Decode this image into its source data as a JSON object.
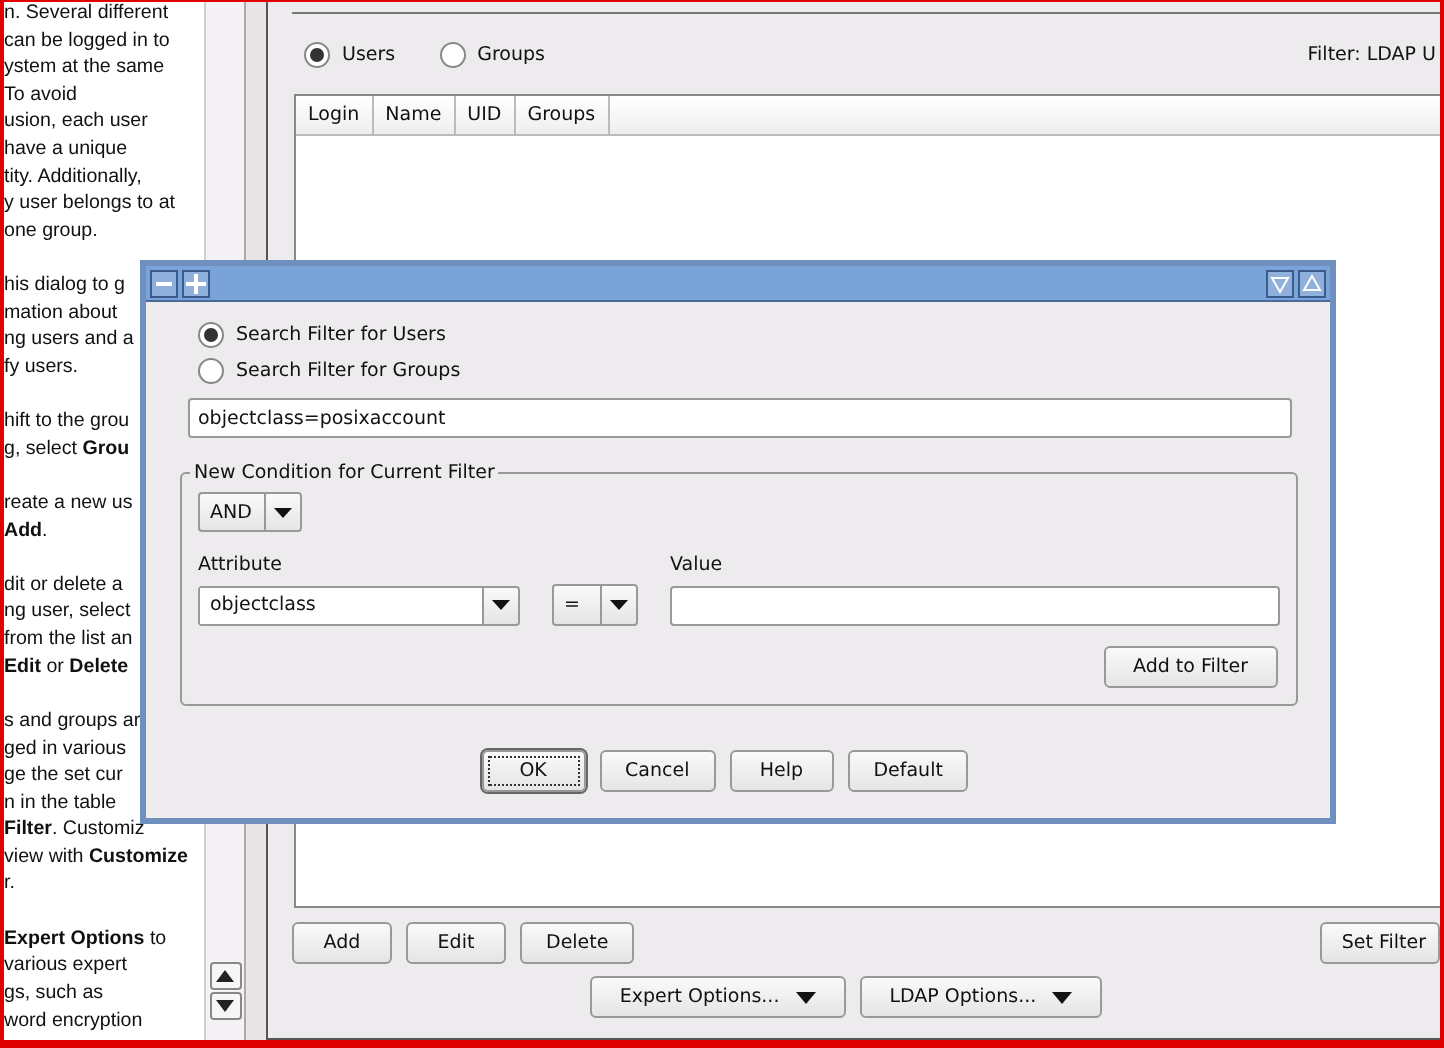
{
  "help_panel": {
    "paragraphs": [
      {
        "lines": [
          "n. Several different",
          "can be logged in to",
          "ystem at the same",
          "To avoid",
          "usion, each user",
          "have a unique",
          "tity. Additionally,",
          "y user belongs to at",
          "one group."
        ]
      },
      {
        "lines": [
          "his dialog to g",
          "mation about",
          "ng users and a",
          "fy users."
        ]
      },
      {
        "lines": [
          "hift to the grou",
          "g, select **Grou**"
        ]
      },
      {
        "lines": [
          "reate a new us",
          "**Add**."
        ]
      },
      {
        "lines": [
          "dit or delete a",
          "ng user, select",
          "from the list an",
          "**Edit** or **Delete**"
        ]
      },
      {
        "lines": [
          "s and groups ar",
          "ged in various",
          "ge the set cur",
          "n in the table",
          "**Filter**. Customiz",
          "view with **Customize**",
          "r."
        ]
      },
      {
        "lines": [
          "**Expert Options** to",
          "various expert",
          "gs, such as",
          "word encryption"
        ]
      }
    ]
  },
  "main": {
    "view_options": [
      {
        "label": "Users",
        "selected": true
      },
      {
        "label": "Groups",
        "selected": false
      }
    ],
    "filter_label": "Filter: LDAP U",
    "table": {
      "columns": [
        "Login",
        "Name",
        "UID",
        "Groups"
      ]
    },
    "buttons": [
      "Add",
      "Edit",
      "Delete"
    ],
    "set_filter_button": "Set Filter",
    "option_menus": [
      "Expert Options...",
      "LDAP Options..."
    ]
  },
  "dialog": {
    "filter_targets": [
      {
        "label": "Search Filter for Users",
        "selected": true
      },
      {
        "label": "Search Filter for Groups",
        "selected": false
      }
    ],
    "filter_text": "objectclass=posixaccount",
    "condition_group": {
      "title": "New Condition for Current Filter",
      "operator": "AND",
      "attribute_label": "Attribute",
      "attribute": "objectclass",
      "comparison": "=",
      "value_label": "Value",
      "add_button": "Add to Filter"
    },
    "buttons": [
      {
        "label": "OK",
        "focused": true
      },
      {
        "label": "Cancel",
        "focused": false
      },
      {
        "label": "Help",
        "focused": false
      },
      {
        "label": "Default",
        "focused": false
      }
    ]
  }
}
